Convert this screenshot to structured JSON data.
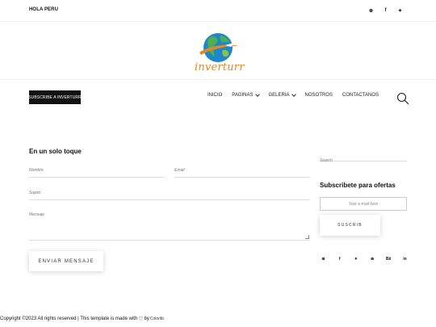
{
  "topbar": {
    "greeting": "HOLA PERU",
    "social": [
      {
        "name": "pinterest-icon",
        "glyph": "⊛"
      },
      {
        "name": "facebook-icon",
        "glyph": "f"
      },
      {
        "name": "twitter-icon",
        "glyph": "✦"
      }
    ]
  },
  "logo": {
    "text": "inverturr"
  },
  "header": {
    "subscribe_label": "SUBSCRIBE A INVERTURR",
    "nav": [
      {
        "label": "INICIO",
        "has_dropdown": false
      },
      {
        "label": "PAGINAS",
        "has_dropdown": true
      },
      {
        "label": "GELERIA",
        "has_dropdown": true
      },
      {
        "label": "NOSOTROS",
        "has_dropdown": false
      },
      {
        "label": "CONTACTANOS",
        "has_dropdown": false
      }
    ]
  },
  "contact": {
    "title": "En un solo toque",
    "name_placeholder": "Nombre",
    "email_placeholder": "Email",
    "subject_placeholder": "Sujeto",
    "message_placeholder": "Mensaje",
    "send_label": "ENVIAR MENSAJE"
  },
  "sidebar": {
    "search_placeholder": "Search",
    "subscribe_title": "Subscribete para ofertas",
    "email_placeholder": "Your e-mail here",
    "subscribe_label": "SUSCRIB",
    "social": [
      {
        "name": "pinterest-icon",
        "glyph": "⊛"
      },
      {
        "name": "facebook-icon",
        "glyph": "f"
      },
      {
        "name": "twitter-icon",
        "glyph": "✦"
      },
      {
        "name": "dribbble-icon",
        "glyph": "⊕"
      },
      {
        "name": "behance-icon",
        "glyph": "Bē"
      },
      {
        "name": "linkedin-icon",
        "glyph": "in"
      }
    ]
  },
  "footer": {
    "text": "Copyright ©2023 All rights reserved | This template is made with",
    "by": "by",
    "brand": "Colorlib"
  },
  "colors": {
    "accent": "#e0892a",
    "dark": "#111111",
    "globe": "#1f87c9"
  }
}
